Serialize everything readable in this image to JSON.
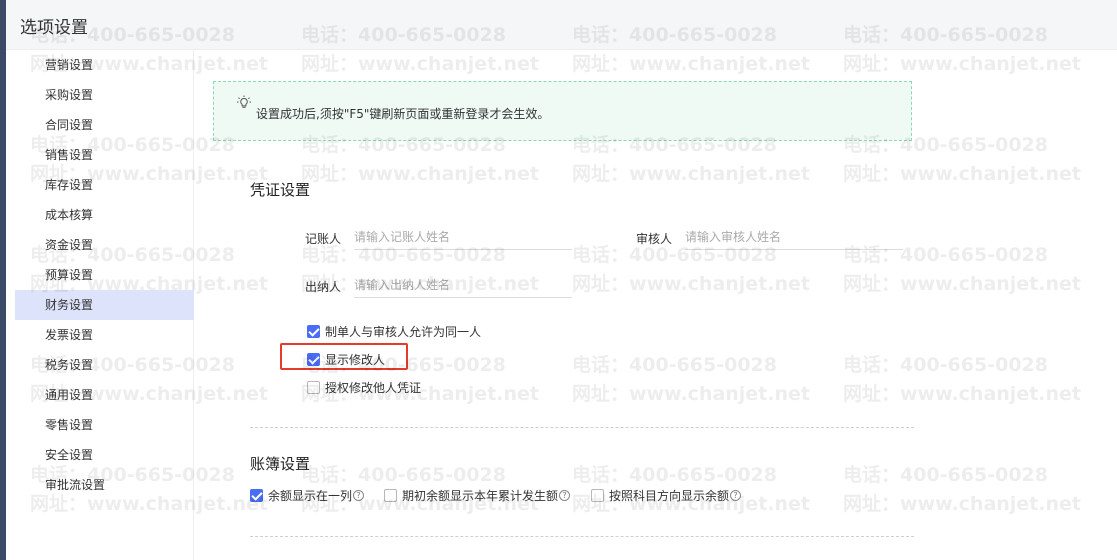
{
  "window": {
    "title": "选项设置"
  },
  "sidebar": {
    "items": [
      {
        "label": "营销设置"
      },
      {
        "label": "采购设置"
      },
      {
        "label": "合同设置"
      },
      {
        "label": "销售设置"
      },
      {
        "label": "库存设置"
      },
      {
        "label": "成本核算"
      },
      {
        "label": "资金设置"
      },
      {
        "label": "预算设置"
      },
      {
        "label": "财务设置",
        "active": true
      },
      {
        "label": "发票设置"
      },
      {
        "label": "税务设置"
      },
      {
        "label": "通用设置"
      },
      {
        "label": "零售设置"
      },
      {
        "label": "安全设置"
      },
      {
        "label": "审批流设置"
      }
    ]
  },
  "notice": {
    "text": "设置成功后,须按\"F5\"键刷新页面或重新登录才会生效。",
    "icon": "bulb-icon"
  },
  "voucher": {
    "title": "凭证设置",
    "bookkeeper": {
      "label": "记账人",
      "placeholder": "请输入记账人姓名",
      "value": ""
    },
    "reviewer": {
      "label": "审核人",
      "placeholder": "请输入审核人姓名",
      "value": ""
    },
    "cashier": {
      "label": "出纳人",
      "placeholder": "请输入出纳人姓名",
      "value": ""
    },
    "options": [
      {
        "label": "制单人与审核人允许为同一人",
        "checked": true
      },
      {
        "label": "显示修改人",
        "checked": true
      },
      {
        "label": "授权修改他人凭证",
        "checked": false
      }
    ]
  },
  "ledger": {
    "title": "账簿设置",
    "options": [
      {
        "label": "余额显示在一列",
        "checked": true
      },
      {
        "label": "期初余额显示本年累计发生额",
        "checked": false
      },
      {
        "label": "按照科目方向显示余额",
        "checked": false
      }
    ]
  },
  "watermark": {
    "phone": "电话：400-665-0028",
    "site": "网址：www.chanjet.net"
  },
  "colors": {
    "accent": "#4a6cf7",
    "active_bg": "#dde3fa",
    "highlight": "#e53b2b",
    "notice_bg": "#effaf5"
  }
}
